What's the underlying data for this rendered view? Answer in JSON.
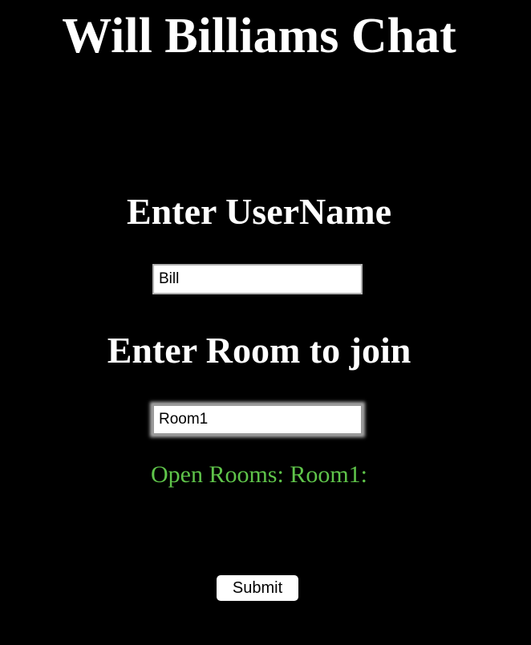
{
  "header": {
    "title": "Will Billiams Chat"
  },
  "form": {
    "username_heading": "Enter UserName",
    "username_value": "Bill",
    "room_heading": "Enter Room to join",
    "room_value": "Room1",
    "open_rooms_text": "Open Rooms: Room1:",
    "submit_label": "Submit"
  },
  "colors": {
    "background": "#000000",
    "text": "#ffffff",
    "open_rooms": "#5fc44a"
  }
}
